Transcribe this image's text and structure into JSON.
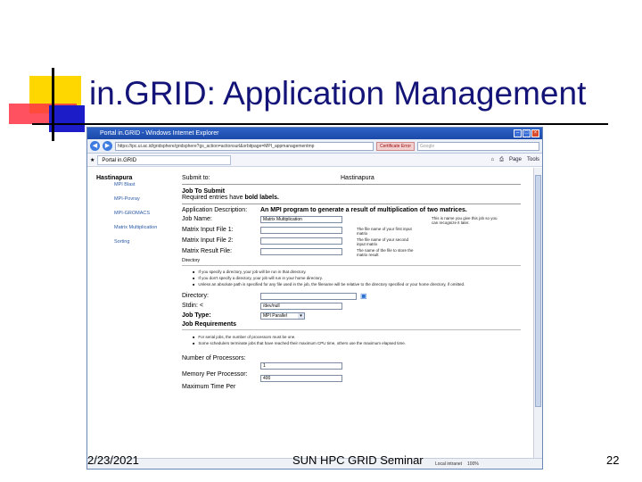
{
  "slide": {
    "title": "in.GRID: Application Management",
    "footer_date": "2/23/2021",
    "footer_center": "SUN HPC GRID Seminar",
    "page_number": "22"
  },
  "browser": {
    "window_title": "Portal in.GRID - Windows Internet Explorer",
    "address": "https://ipc.ui.ac.id/gridsphere/gridsphere?gs_action=actionsurl&orbitpage=MPI_appmanagementmp",
    "cert_label": "Certificate Error",
    "search_placeholder": "Google",
    "tab_label": "Portal in.GRID",
    "tools": {
      "page": "Page",
      "tools": "Tools"
    },
    "status": {
      "zone": "Local intranet",
      "zoom": "100%"
    }
  },
  "sidebar": {
    "title": "Hastinapura",
    "items": [
      "MPI Blast",
      "MPI-Povray",
      "MPI-GROMACS",
      "Matrix Multiplication",
      "Sorting"
    ]
  },
  "form": {
    "submit_to_label": "Submit to:",
    "submit_to_value": "Hastinapura",
    "job_to_submit": "Job To Submit",
    "required_note_prefix": "Required entries have ",
    "required_note_bold": "bold labels.",
    "app_desc_label": "Application Description:",
    "app_desc_value": "An MPI program to generate a result of multiplication of two matrices.",
    "job_name_label": "Job Name:",
    "job_name_value": "Matrix Multiplication",
    "job_name_hint": "This is name you give this job so you can recognize it later.",
    "input1_label": "Matrix Input File 1:",
    "input1_hint": "The file name of your first input matrix",
    "input2_label": "Matrix Input File 2:",
    "input2_hint": "The file name of your second input matrix",
    "result_label": "Matrix Result File:",
    "result_hint": "The name of the file to store the matrix result",
    "directory_small": "Directory",
    "dir_bullets": [
      "If you specify a directory, your job will be run in that directory.",
      "If you don't specify a directory, your job will run in your home directory.",
      "Unless an absolute path is specified for any file used in the job, the filename will be relative to the directory specified or your home directory, if omitted."
    ],
    "directory_label": "Directory:",
    "stdin_label": "Stdin: <",
    "stdin_value": "/dev/null",
    "jobtype_label": "Job Type:",
    "jobtype_value": "MPI Parallel",
    "job_req": "Job Requirements",
    "req_bullets": [
      "For serial jobs, the number of processors must be one.",
      "Some schedulers terminate jobs that have reached their maximum CPU time, others use the maximum elapsed time."
    ],
    "nproc_label": "Number of Processors:",
    "nproc_value": "1",
    "mem_label": "Memory Per Processor:",
    "mem_value": "400",
    "maxtime_label": "Maximum Time Per"
  }
}
